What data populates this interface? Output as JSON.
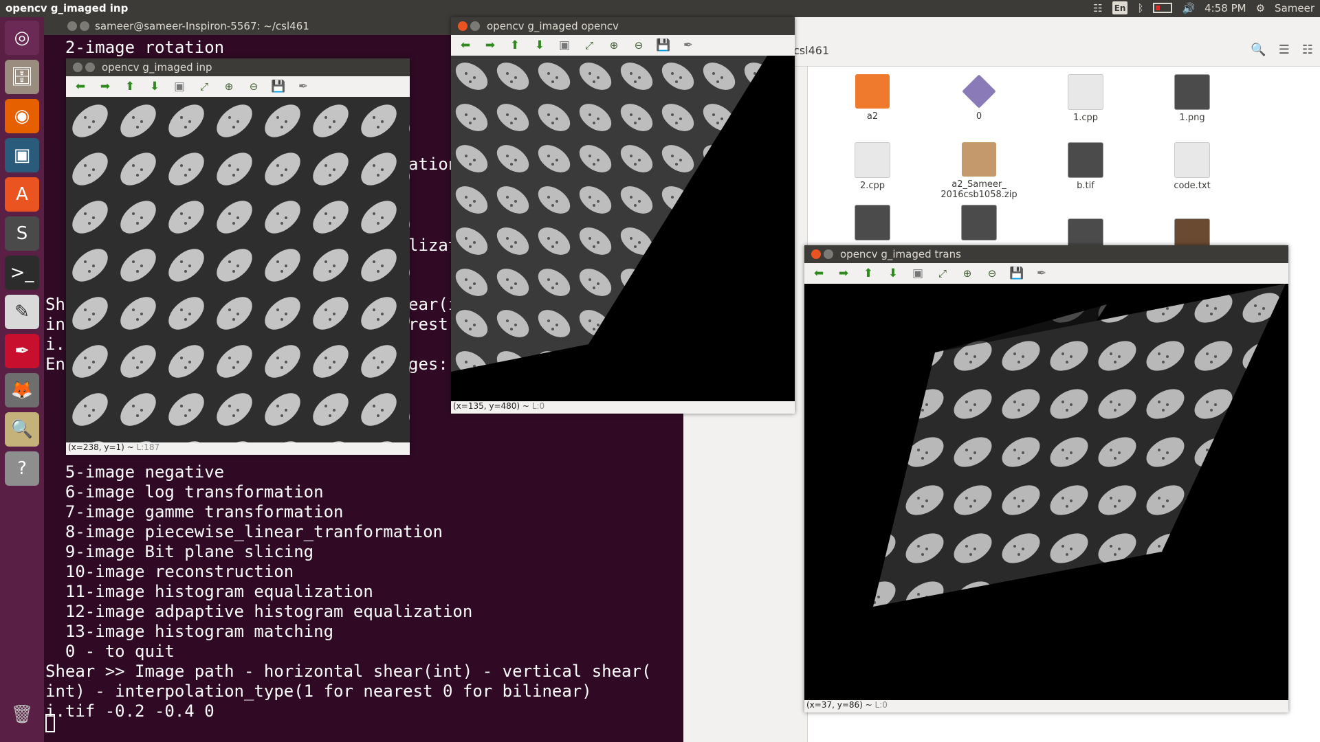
{
  "top_panel": {
    "app_title": "opencv g_imaged inp",
    "keyboard": "En",
    "time": "4:58 PM",
    "user": "Sameer",
    "icons": [
      "wifi-icon",
      "keyboard-icon",
      "bluetooth-icon",
      "battery-icon",
      "volume-icon",
      "gear-icon"
    ]
  },
  "launcher": {
    "items": [
      "ubuntu-logo-icon",
      "files-icon",
      "firefox-icon",
      "workspace-icon",
      "software-center-icon",
      "sublime-icon",
      "terminal-icon",
      "text-editor-icon",
      "document-viewer-icon",
      "gimp-icon",
      "image-viewer-icon",
      "help-icon",
      "trash-icon"
    ]
  },
  "terminal": {
    "title": "sameer@sameer-Inspiron-5567: ~/csl461",
    "line_top": "  2-image rotation",
    "fragments_behind": [
      {
        "left": "",
        "right": "ation"
      },
      {
        "left": "",
        "right": "lizat"
      },
      {
        "left": "Sh",
        "right": "ear(i"
      },
      {
        "left": "in",
        "right": "rest"
      },
      {
        "left": "i.",
        "right": ""
      },
      {
        "left": "En",
        "right": "ges:"
      }
    ],
    "menu": [
      "  5-image negative",
      "  6-image log transformation",
      "  7-image gamme transformation",
      "  8-image piecewise_linear_tranformation",
      "  9-image Bit plane slicing",
      "  10-image reconstruction",
      "  11-image histogram equalization",
      "  12-image adpaptive histogram equalization",
      "  13-image histogram matching",
      "  0 - to quit"
    ],
    "prompt1": "Shear >> Image path - horizontal shear(int) - vertical shear(",
    "prompt2": "int) - interpolation_type(1 for nearest 0 for bilinear)",
    "input": "i.tif -0.2 -0.4 0"
  },
  "files": {
    "path": "csl461",
    "items": [
      {
        "name": "a2",
        "kind": "folder"
      },
      {
        "name": "0",
        "kind": "misc"
      },
      {
        "name": "1.cpp",
        "kind": "doc"
      },
      {
        "name": "1.png",
        "kind": "thumb"
      },
      {
        "name": "2.cpp",
        "kind": "doc"
      },
      {
        "name": "a2_Sameer_\n2016csb1058.zip",
        "kind": "zip"
      },
      {
        "name": "b.tif",
        "kind": "thumb"
      },
      {
        "name": "code.txt",
        "kind": "doc"
      }
    ]
  },
  "windows": {
    "inp": {
      "title": "opencv g_imaged inp",
      "status": "(x=238, y=1) ~",
      "level": "L:187"
    },
    "opencv": {
      "title": "opencv g_imaged opencv",
      "status": "(x=135, y=480) ~",
      "level": "L:0"
    },
    "trans": {
      "title": "opencv g_imaged trans",
      "status": "(x=37, y=86) ~",
      "level": "L:0"
    }
  },
  "toolbar_buttons": [
    "arrow-left-icon",
    "arrow-right-icon",
    "arrow-up-icon",
    "arrow-down-icon",
    "image-icon",
    "zoom-fit-icon",
    "zoom-in-icon",
    "zoom-out-icon",
    "save-icon",
    "properties-icon"
  ]
}
